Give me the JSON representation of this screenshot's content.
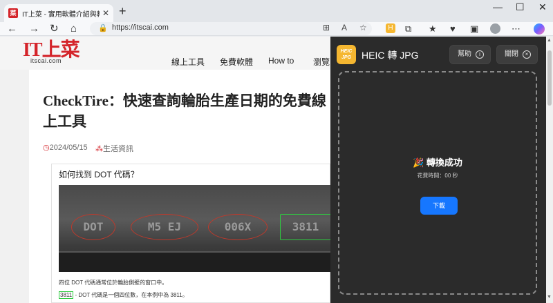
{
  "browser": {
    "tab_title": "IT上菜 - 實用軟體介紹與教學 - 就",
    "tab_favicon_text": "菜",
    "url": "https://itscai.com"
  },
  "site": {
    "logo_text": "IT上菜",
    "logo_sub": "itscai.com",
    "nav": [
      "線上工具",
      "免費軟體",
      "How to",
      "瀏覽"
    ]
  },
  "article": {
    "title": "CheckTire：快速查詢輪胎生產日期的免費線上工具",
    "date": "2024/05/15",
    "category": "生活資訊",
    "figure_heading": "如何找到 DOT 代碼？",
    "tire_marks": [
      "DOT",
      "M5 EJ",
      "006X",
      "3811"
    ],
    "caption1": "四位 DOT 代碼通常位於輪胎側壁的窗口中。",
    "caption2_code": "3811",
    "caption2_text": "- DOT 代碼是一個四位數，在本例中為 3811。"
  },
  "extension": {
    "logo_text": "HEIC JPG",
    "title": "HEIC 轉 JPG",
    "help_label": "幫助",
    "close_label": "關閉",
    "success_icon": "🎉",
    "success_text": "轉換成功",
    "elapsed_text": "花費時間：00 秒",
    "download_label": "下載"
  },
  "colors": {
    "brand_red": "#d4242a",
    "panel_bg": "#2b2b2b",
    "accent_blue": "#1677ff",
    "ext_logo": "#f5b731"
  }
}
